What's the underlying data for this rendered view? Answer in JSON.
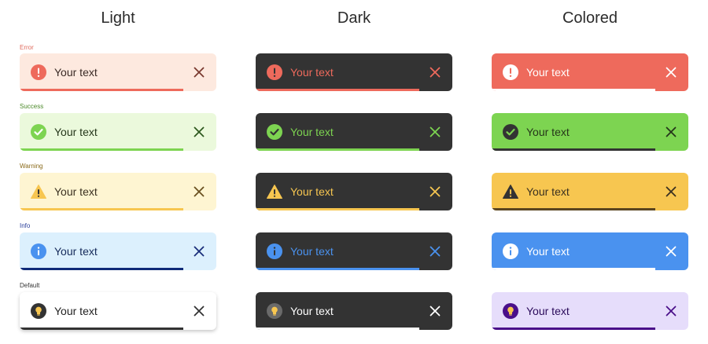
{
  "columns": [
    {
      "title": "Light"
    },
    {
      "title": "Dark"
    },
    {
      "title": "Colored"
    }
  ],
  "rows": [
    {
      "label": "Error",
      "label_color": "#e06a5c"
    },
    {
      "label": "Success",
      "label_color": "#4c8a2a"
    },
    {
      "label": "Warning",
      "label_color": "#8a6a1a"
    },
    {
      "label": "Info",
      "label_color": "#2a3f9a"
    },
    {
      "label": "Default",
      "label_color": "#333333"
    }
  ],
  "toast_text": "Your text",
  "progress_fraction": 0.83,
  "toasts": {
    "light": [
      {
        "type": "error",
        "icon": "error-icon",
        "bg": "#fde9df",
        "text": "#3a2a25",
        "icon_color": "#ee6a5c",
        "close": "#7a3a30",
        "bar": "#ee6a5c"
      },
      {
        "type": "success",
        "icon": "check-circle-icon",
        "bg": "#ebf9dc",
        "text": "#25361a",
        "icon_color": "#7dd451",
        "close": "#2f5a20",
        "bar": "#7dd451"
      },
      {
        "type": "warning",
        "icon": "warning-triangle-icon",
        "bg": "#fef5d2",
        "text": "#3a3020",
        "icon_color": "#f7c650",
        "close": "#6a5020",
        "bar": "#f7c650"
      },
      {
        "type": "info",
        "icon": "info-icon",
        "bg": "#dcf0fd",
        "text": "#152a5a",
        "icon_color": "#4a92ef",
        "close": "#1a2e7a",
        "bar": "#0f2a78"
      },
      {
        "type": "default",
        "icon": "lightbulb-icon",
        "bg": "#ffffff",
        "text": "#222222",
        "icon_color": "#333333",
        "close": "#333333",
        "bar": "#333333"
      }
    ],
    "dark": [
      {
        "type": "error",
        "icon": "error-icon",
        "bg": "#333333",
        "text": "#ee6a5c",
        "icon_color": "#ee6a5c",
        "close": "#ee6a5c",
        "bar": "#ee6a5c"
      },
      {
        "type": "success",
        "icon": "check-circle-icon",
        "bg": "#333333",
        "text": "#7dd451",
        "icon_color": "#7dd451",
        "close": "#7dd451",
        "bar": "#7dd451"
      },
      {
        "type": "warning",
        "icon": "warning-triangle-icon",
        "bg": "#333333",
        "text": "#f7c650",
        "icon_color": "#f7c650",
        "close": "#f7c650",
        "bar": "#f7c650"
      },
      {
        "type": "info",
        "icon": "info-icon",
        "bg": "#333333",
        "text": "#4a92ef",
        "icon_color": "#4a92ef",
        "close": "#4a92ef",
        "bar": "#4a92ef"
      },
      {
        "type": "default",
        "icon": "lightbulb-icon",
        "bg": "#333333",
        "text": "#ffffff",
        "icon_color": "#6a6a6a",
        "close": "#ffffff",
        "bar": "#ffffff"
      }
    ],
    "colored": [
      {
        "type": "error",
        "icon": "error-icon",
        "bg": "#ee6a5c",
        "text": "#ffffff",
        "icon_color": "#ffffff",
        "close": "#ffffff",
        "bar": "#ffffff"
      },
      {
        "type": "success",
        "icon": "check-circle-icon",
        "bg": "#7dd451",
        "text": "#25361a",
        "icon_color": "#333333",
        "close": "#25361a",
        "bar": "#333333"
      },
      {
        "type": "warning",
        "icon": "warning-triangle-icon",
        "bg": "#f7c650",
        "text": "#3a3020",
        "icon_color": "#333333",
        "close": "#3a3020",
        "bar": "#5a4520"
      },
      {
        "type": "info",
        "icon": "info-icon",
        "bg": "#4a92ef",
        "text": "#ffffff",
        "icon_color": "#ffffff",
        "close": "#ffffff",
        "bar": "#ffffff"
      },
      {
        "type": "default",
        "icon": "lightbulb-icon",
        "bg": "#e6ddfb",
        "text": "#2a0a5a",
        "icon_color": "#4a0f8a",
        "close": "#4a0f8a",
        "bar": "#4a0f8a"
      }
    ]
  }
}
